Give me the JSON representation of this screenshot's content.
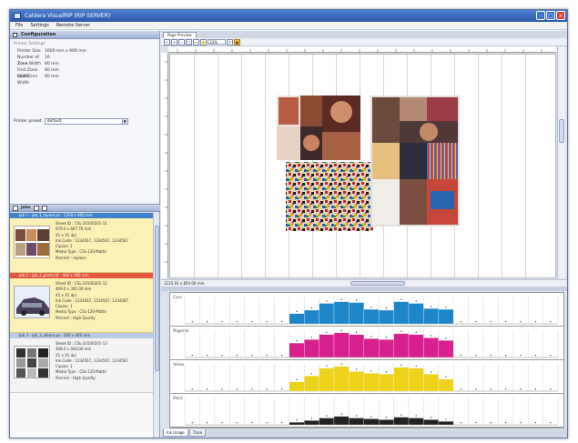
{
  "window": {
    "title": "Caldera VisualRIP (RIP SERVER)"
  },
  "menu": {
    "items": [
      "File",
      "Settings",
      "Remote Server"
    ]
  },
  "config_panel": {
    "title": "Configuration",
    "group_title": "Printer Settings",
    "rows": [
      {
        "label": "Printer Size",
        "value": "1600 mm x 900 mm"
      },
      {
        "label": "Number of Zone",
        "value": "16"
      },
      {
        "label": "Zone Width",
        "value": "80 mm"
      },
      {
        "label": "First Zone Width",
        "value": "80 mm"
      },
      {
        "label": "Last Zone Width",
        "value": "80 mm"
      }
    ],
    "preset_label": "Printer preset",
    "preset_value": "default"
  },
  "jobs_panel": {
    "title": "Jobs",
    "jobs": [
      {
        "bar": "Job 1 - job_1_layout.ps - 1300 x 900 mm",
        "bar_color": "blue",
        "lines": [
          "Sheet ID : CSL-20100201-11",
          "979.0 x 667.76 mm",
          "X1 x X1 dpi",
          "Ink Code : 1234567, 1234567, 1234567",
          "Copies: 1",
          "Media Type : CSL-120-Matte",
          "Percent : replace"
        ]
      },
      {
        "bar": "Job 2 - job_2_photo.tif - 400 x 300 mm",
        "bar_color": "red",
        "lines": [
          "Sheet ID : CSL-20100201-12",
          "409.0 x 301.00 mm",
          "X1 x X1 dpi",
          "Ink Code : 1234567, 1234567, 1234567",
          "Copies: 1",
          "Media Type : CSL-120-Matte",
          "Percent : High Quality"
        ]
      },
      {
        "bar": "Job 3 - job_3_album.ps - 400 x 400 mm",
        "bar_color": "light",
        "lines": [
          "Sheet ID : CSL-20100201-13",
          "408.0 x 400.00 mm",
          "X1 x X1 dpi",
          "Ink Code : 1234567, 1234567, 1234567",
          "Copies: 1",
          "Media Type : CSL-120-Matte",
          "Percent : High Quality"
        ]
      }
    ]
  },
  "preview": {
    "tab": "Page Preview",
    "zoom": "33%",
    "coords": "1215.91 x 854.00 mm"
  },
  "ink_chart": {
    "tabs": [
      "Ink Usage",
      "Trace"
    ]
  },
  "chart_data": [
    {
      "type": "bar",
      "title": "Cyan",
      "color": "#1d86c8",
      "values": [
        0,
        0,
        0,
        0,
        0,
        0,
        0,
        12,
        16,
        24,
        26,
        25,
        17,
        16,
        26,
        24,
        18,
        17,
        0,
        0,
        0,
        0,
        0,
        0,
        0
      ],
      "ylim": [
        0,
        32
      ]
    },
    {
      "type": "bar",
      "title": "Magenta",
      "color": "#d8208f",
      "values": [
        0,
        0,
        0,
        0,
        0,
        0,
        0,
        17,
        21,
        27,
        29,
        27,
        22,
        21,
        28,
        27,
        23,
        20,
        0,
        0,
        0,
        0,
        0,
        0,
        0
      ],
      "ylim": [
        0,
        32
      ]
    },
    {
      "type": "bar",
      "title": "Yellow",
      "color": "#ecd21a",
      "values": [
        0,
        0,
        0,
        0,
        0,
        0,
        0,
        11,
        18,
        27,
        29,
        23,
        21,
        20,
        28,
        27,
        20,
        14,
        0,
        0,
        0,
        0,
        0,
        0,
        0
      ],
      "ylim": [
        0,
        32
      ]
    },
    {
      "type": "bar",
      "title": "Black",
      "color": "#222222",
      "values": [
        0,
        0,
        0,
        0,
        0,
        0,
        0,
        3,
        5,
        8,
        10,
        8,
        7,
        6,
        9,
        8,
        6,
        4,
        0,
        0,
        0,
        0,
        0,
        0,
        0
      ],
      "ylim": [
        0,
        32
      ]
    }
  ]
}
